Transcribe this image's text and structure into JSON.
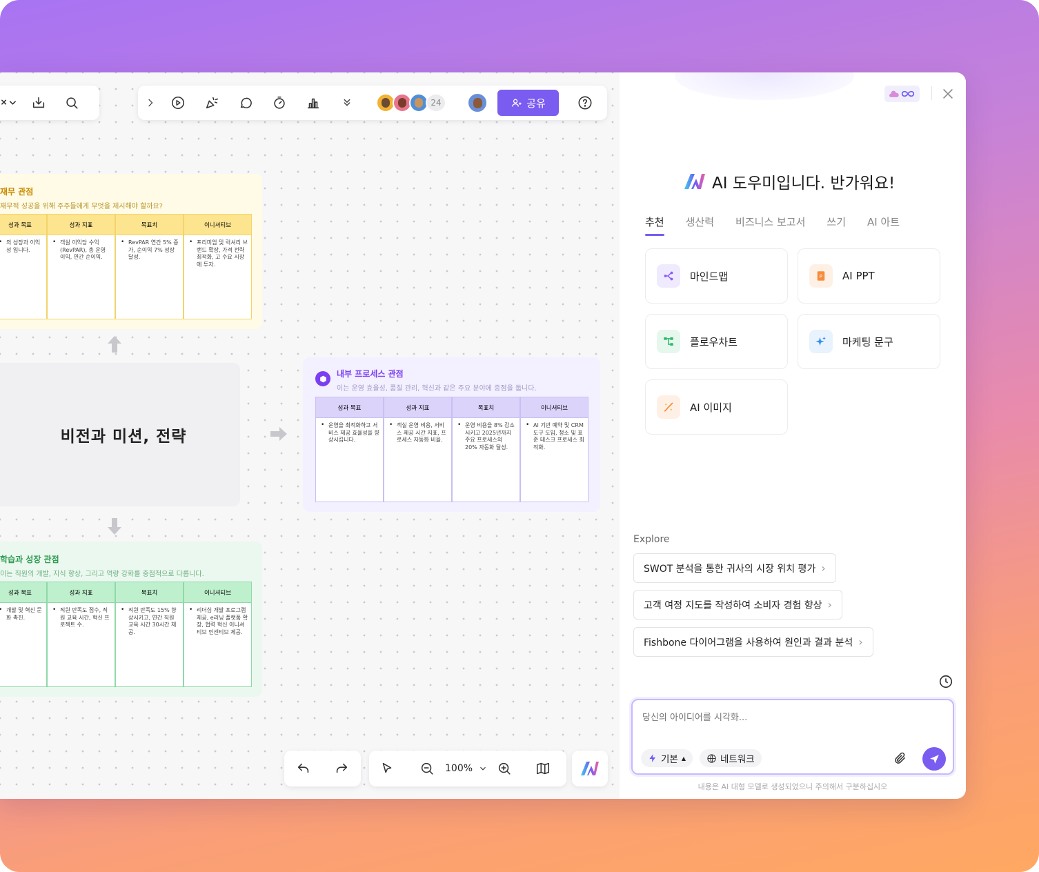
{
  "toolbar": {
    "collaborator_count": "24",
    "share_label": "공유"
  },
  "canvas": {
    "center_title": "비전과 미션, 전략",
    "zoom_level": "100%",
    "finance_card": {
      "title": "재무 관점",
      "subtitle": "재무적 성공을 위해 주주들에게 무엇을 제시해야 할까요?",
      "headers": [
        "성과 목표",
        "성과 지표",
        "목표치",
        "이니셔티브"
      ],
      "cells": [
        "의 성장과 이익성 입니다.",
        "객실 이익당 수익 (RevPAR), 총 운영 이익, 연간 순이익.",
        "RevPAR 연간 5% 증가, 순이익 7% 성장 달성.",
        "프리미엄 및 럭셔리 브랜드 확장, 가격 전략 최적화, 고 수요 시장에 투자."
      ]
    },
    "process_card": {
      "title": "내부 프로세스 관점",
      "subtitle": "이는 운영 효율성, 품질 관리, 혁신과 같은 주요 분야에 중점을 둡니다.",
      "headers": [
        "성과 목표",
        "성과 지표",
        "목표치",
        "이니셔티브"
      ],
      "cells": [
        "운영을 최적화하고 서비스 제공 효율성을 향상시킵니다.",
        "객실 운영 비용, 서비스 제공 시간 지표, 프로세스 자동화 비율.",
        "운영 비용을 8% 감소시키고 2025년까지 주요 프로세스의 20% 자동화 달성.",
        "AI 기반 예약 및 CRM 도구 도입, 청소 및 표준 테스크 프로세스 최적화."
      ]
    },
    "learning_card": {
      "title": "학습과 성장 관점",
      "subtitle": "이는 직원의 개발, 지식 향상, 그리고 역량 강화를 중점적으로 다룹니다.",
      "headers": [
        "성과 목표",
        "성과 지표",
        "목표치",
        "이니셔티브"
      ],
      "cells": [
        "개발 및 혁신 문 화 촉진.",
        "직원 만족도 점수, 직원 교육 시간, 혁신 프로젝트 수.",
        "직원 만족도 15% 향상시키고, 연간 직원 교육 시간 30시간 제공.",
        "리더십 개발 프로그램 제공, e러닝 플랫폼 확장, 협력 혁신 이니셔티브 인센티브 제공."
      ]
    }
  },
  "panel": {
    "greeting": "AI 도우미입니다. 반가워요!",
    "tabs": [
      "추천",
      "생산력",
      "비즈니스 보고서",
      "쓰기",
      "AI 아트"
    ],
    "features": [
      "마인드맵",
      "AI PPT",
      "플로우차트",
      "마케팅 문구",
      "AI 이미지"
    ],
    "explore_label": "Explore",
    "explore_items": [
      "SWOT 분석을 통한 귀사의 시장 위치 평가",
      "고객 여정 지도를 작성하여 소비자 경험 향상",
      "Fishbone 다이어그램을 사용하여 원인과 결과 분석"
    ],
    "input_placeholder": "당신의 아이디어를 시각화...",
    "mode_label": "기본",
    "network_label": "네트워크",
    "disclaimer": "내용은 AI 대형 모델로 생성되었으니 주의해서 구분하십시오"
  },
  "colors": {
    "accent": "#7b5cf0",
    "finance": "#f6c945",
    "process": "#b7a8f3",
    "learning": "#8fd9a8"
  }
}
